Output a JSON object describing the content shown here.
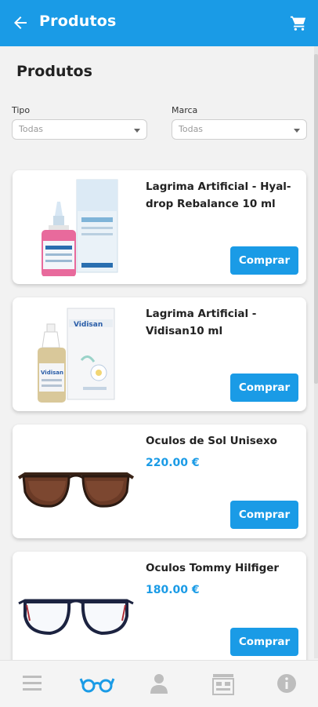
{
  "header": {
    "title": "Produtos"
  },
  "page": {
    "title": "Produtos"
  },
  "filters": {
    "tipo": {
      "label": "Tipo",
      "value": "Todas"
    },
    "marca": {
      "label": "Marca",
      "value": "Todas"
    }
  },
  "products": [
    {
      "name": "Lagrima Artificial - Hyal-drop Rebalance 10 ml",
      "price": "",
      "button": "Comprar",
      "image_icon": "eye-drops-bottle-icon"
    },
    {
      "name": "Lagrima Artificial - Vidisan10 ml",
      "price": "",
      "button": "Comprar",
      "image_icon": "eye-drops-bottle-icon"
    },
    {
      "name": "Oculos de Sol Unisexo",
      "price": "220.00 €",
      "button": "Comprar",
      "image_icon": "sunglasses-icon"
    },
    {
      "name": "Oculos Tommy Hilfiger",
      "price": "180.00 €",
      "button": "Comprar",
      "image_icon": "eyeglasses-icon"
    }
  ],
  "colors": {
    "accent": "#1a9be6",
    "nav_inactive": "#bdbdbd"
  },
  "nav_icons": [
    "menu-icon",
    "glasses-icon",
    "user-icon",
    "store-icon",
    "info-icon"
  ]
}
